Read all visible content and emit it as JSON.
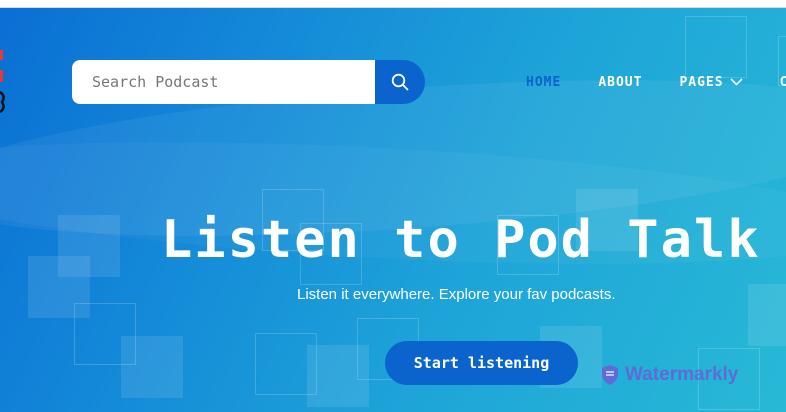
{
  "search": {
    "placeholder": "Search Podcast",
    "icon": "search-icon"
  },
  "nav": {
    "items": [
      {
        "label": "HOME",
        "active": true
      },
      {
        "label": "ABOUT",
        "active": false
      },
      {
        "label": "PAGES",
        "active": false,
        "icon": "chevron-down-icon"
      },
      {
        "label": "C",
        "active": false
      }
    ]
  },
  "hero": {
    "title": "Listen to Pod Talk",
    "subtitle": "Listen it everywhere. Explore your fav podcasts.",
    "cta_label": "Start listening"
  },
  "watermark": {
    "text": "Watermarkly",
    "icon": "shield-icon"
  },
  "colors": {
    "accent": "#0b63ce",
    "hero_start": "#0a6fd4",
    "hero_end": "#27b9d6",
    "watermark": "#6a5fd8"
  }
}
